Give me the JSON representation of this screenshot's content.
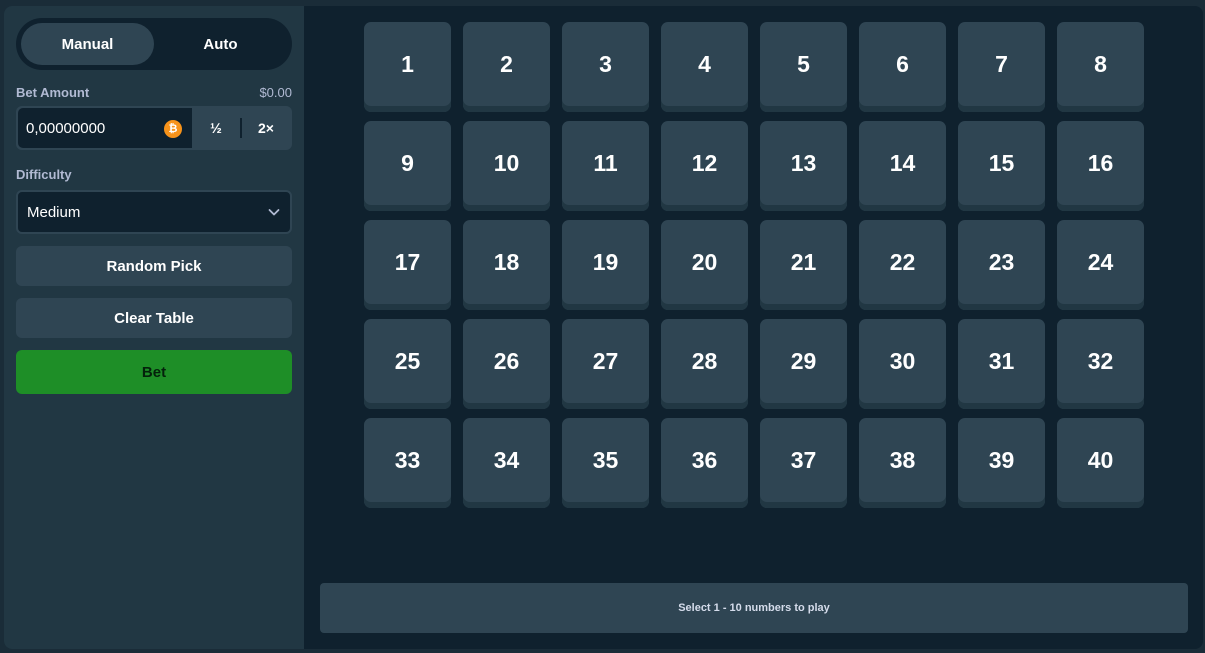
{
  "sidebar": {
    "mode_tabs": [
      {
        "label": "Manual",
        "active": true
      },
      {
        "label": "Auto",
        "active": false
      }
    ],
    "bet_amount": {
      "label": "Bet Amount",
      "usd_value": "$0.00",
      "value": "0,00000000",
      "currency_icon": "bitcoin-icon",
      "currency_symbol": "₿",
      "half_label": "½",
      "double_label": "2×"
    },
    "difficulty": {
      "label": "Difficulty",
      "selected": "Medium",
      "chevron_icon": "chevron-down-icon"
    },
    "random_pick_label": "Random Pick",
    "clear_table_label": "Clear Table",
    "bet_label": "Bet"
  },
  "board": {
    "numbers": [
      "1",
      "2",
      "3",
      "4",
      "5",
      "6",
      "7",
      "8",
      "9",
      "10",
      "11",
      "12",
      "13",
      "14",
      "15",
      "16",
      "17",
      "18",
      "19",
      "20",
      "21",
      "22",
      "23",
      "24",
      "25",
      "26",
      "27",
      "28",
      "29",
      "30",
      "31",
      "32",
      "33",
      "34",
      "35",
      "36",
      "37",
      "38",
      "39",
      "40"
    ]
  },
  "info_bar": {
    "text": "Select 1 - 10 numbers to play"
  },
  "colors": {
    "page_bg": "#0f212e",
    "panel_bg": "#213743",
    "tile_bg": "#2f4553",
    "bet_button": "#1e8e27",
    "bitcoin": "#f7931a"
  }
}
